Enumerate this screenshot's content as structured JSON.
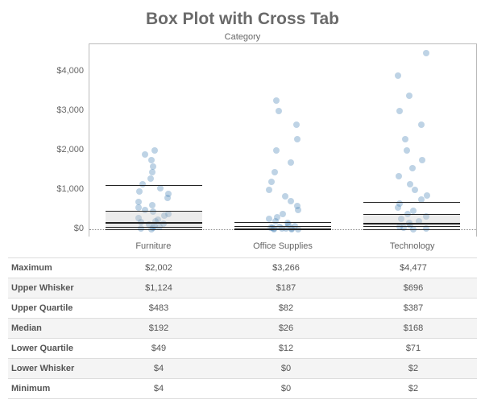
{
  "title": "Box Plot with Cross Tab",
  "subtitle": "Category",
  "y_ticks": [
    "$0",
    "$1,000",
    "$2,000",
    "$3,000",
    "$4,000"
  ],
  "categories": [
    "Furniture",
    "Office Supplies",
    "Technology"
  ],
  "stats": {
    "rows": [
      {
        "label": "Maximum",
        "values": [
          "$2,002",
          "$3,266",
          "$4,477"
        ]
      },
      {
        "label": "Upper Whisker",
        "values": [
          "$1,124",
          "$187",
          "$696"
        ]
      },
      {
        "label": "Upper Quartile",
        "values": [
          "$483",
          "$82",
          "$387"
        ]
      },
      {
        "label": "Median",
        "values": [
          "$192",
          "$26",
          "$168"
        ]
      },
      {
        "label": "Lower Quartile",
        "values": [
          "$49",
          "$12",
          "$71"
        ]
      },
      {
        "label": "Lower Whisker",
        "values": [
          "$4",
          "$0",
          "$2"
        ]
      },
      {
        "label": "Minimum",
        "values": [
          "$4",
          "$0",
          "$2"
        ]
      }
    ]
  },
  "chart_data": {
    "type": "boxplot",
    "xlabel": "Category",
    "ylabel": "",
    "categories": [
      "Furniture",
      "Office Supplies",
      "Technology"
    ],
    "ylim": [
      -200,
      4700
    ],
    "y_ticks": [
      0,
      1000,
      2000,
      3000,
      4000
    ],
    "boxes": [
      {
        "category": "Furniture",
        "min": 4,
        "lower_whisker": 4,
        "q1": 49,
        "median": 192,
        "q3": 483,
        "upper_whisker": 1124,
        "max": 2002
      },
      {
        "category": "Office Supplies",
        "min": 0,
        "lower_whisker": 0,
        "q1": 12,
        "median": 26,
        "q3": 82,
        "upper_whisker": 187,
        "max": 3266
      },
      {
        "category": "Technology",
        "min": 2,
        "lower_whisker": 2,
        "q1": 71,
        "median": 168,
        "q3": 387,
        "upper_whisker": 696,
        "max": 4477
      }
    ],
    "points": {
      "Furniture": [
        4,
        20,
        45,
        60,
        90,
        120,
        150,
        180,
        210,
        250,
        300,
        350,
        400,
        450,
        500,
        550,
        620,
        700,
        800,
        900,
        970,
        1050,
        1150,
        1300,
        1450,
        1600,
        1750,
        1900,
        2002
      ],
      "Office Supplies": [
        0,
        5,
        10,
        15,
        20,
        25,
        30,
        40,
        55,
        70,
        90,
        120,
        160,
        200,
        260,
        320,
        400,
        500,
        600,
        720,
        850,
        1000,
        1200,
        1450,
        1700,
        2000,
        2300,
        2650,
        3000,
        3266
      ],
      "Technology": [
        2,
        15,
        40,
        70,
        110,
        160,
        210,
        270,
        330,
        400,
        480,
        560,
        650,
        750,
        870,
        1000,
        1150,
        1350,
        1550,
        1750,
        2000,
        2300,
        2650,
        3000,
        3400,
        3900,
        4477
      ]
    }
  }
}
